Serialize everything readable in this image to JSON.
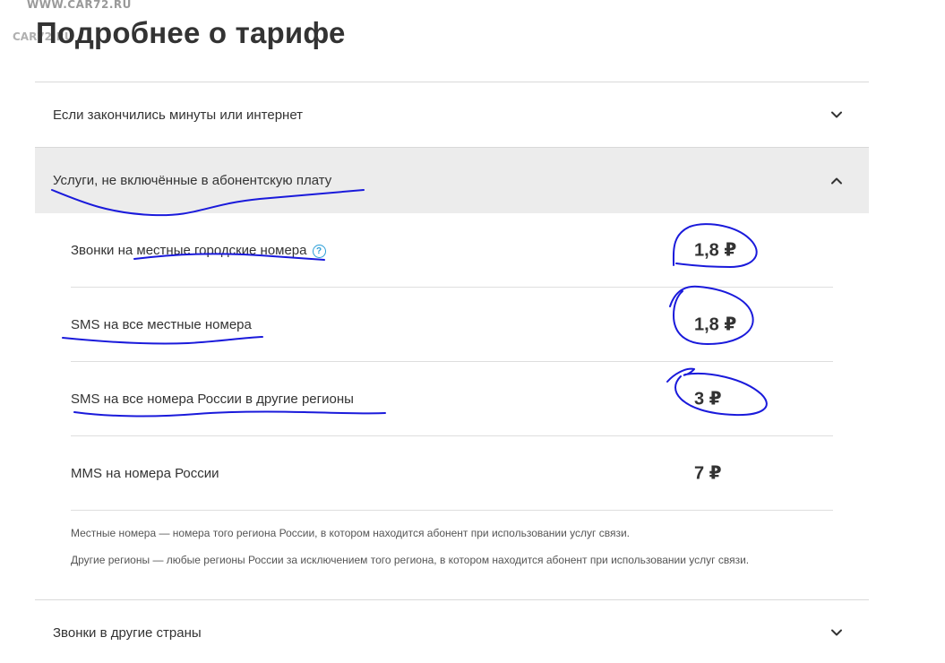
{
  "watermark": {
    "text": "WWW.CAR72.RU",
    "logo": "CAR72.RU"
  },
  "page_title": "Подробнее о тарифе",
  "accordion": [
    {
      "title": "Если закончились минуты или интернет",
      "state": "collapsed",
      "icon": "chevron-down-icon"
    },
    {
      "title": "Услуги, не включённые в абонентскую плату",
      "state": "expanded",
      "icon": "chevron-up-icon"
    }
  ],
  "services": [
    {
      "label": "Звонки на местные городские номера",
      "price": "1,8 ₽",
      "has_help": true,
      "help_icon": "?"
    },
    {
      "label": "SMS на все местные номера",
      "price": "1,8 ₽",
      "has_help": false
    },
    {
      "label": "SMS на все номера России в другие регионы",
      "price": "3 ₽",
      "has_help": false
    },
    {
      "label": "MMS на номера России",
      "price": "7 ₽",
      "has_help": false
    }
  ],
  "notes": [
    "Местные номера — номера того региона России, в котором находится абонент при использовании услуг связи.",
    "Другие регионы — любые регионы России за исключением того региона, в котором находится абонент при использовании услуг связи."
  ],
  "bottom_section": {
    "title": "Звонки в другие страны",
    "state": "collapsed",
    "icon": "chevron-down-icon"
  },
  "colors": {
    "text": "#333333",
    "expanded_bg": "#ececec",
    "help_blue": "#2b9fd8",
    "ink": "#1a1adb",
    "divider": "#d9d9d9"
  }
}
